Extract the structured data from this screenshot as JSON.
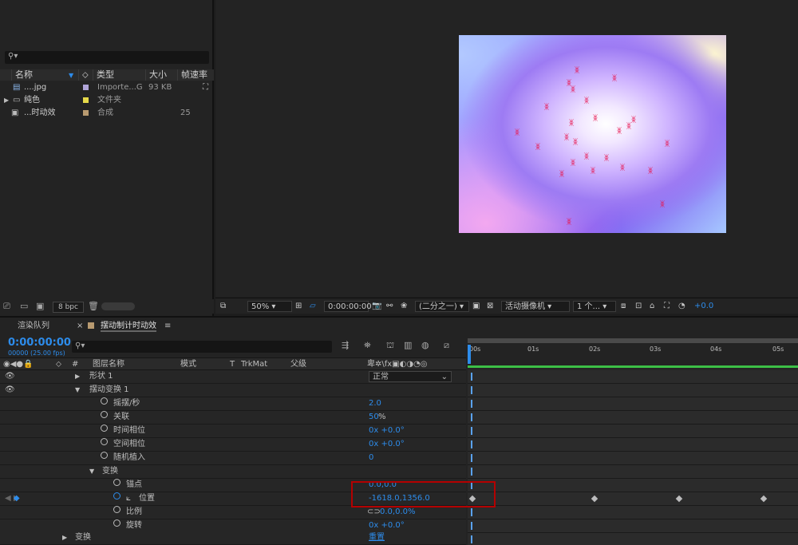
{
  "project": {
    "search_placeholder": "",
    "headers": {
      "name": "名称",
      "type": "类型",
      "size": "大小",
      "fps": "帧速率"
    },
    "items": [
      {
        "name": "....jpg",
        "type": "Importe...G",
        "size": "93 KB",
        "fps": "",
        "color": "#b0a4d8"
      },
      {
        "name": "纯色",
        "type": "文件夹",
        "size": "",
        "fps": "",
        "color": "#e6d94a"
      },
      {
        "name": "...时动效",
        "type": "合成",
        "size": "",
        "fps": "25",
        "color": "#b89a70"
      }
    ],
    "bpc": "8 bpc"
  },
  "viewer": {
    "zoom": "50%",
    "timecode": "0:00:00:00",
    "resolution": "(二分之一)",
    "camera": "活动摄像机",
    "views": "1 个...",
    "exposure": "+0.0"
  },
  "timeline": {
    "tab_render": "渲染队列",
    "tab_comp": "摆动制计时动效",
    "time": "0:00:00:00",
    "fps_info": "00000 (25.00 fps)",
    "columns": {
      "num": "#",
      "layer_name": "图层名称",
      "mode": "模式",
      "t": "T",
      "trkmat": "TrkMat",
      "parent": "父级"
    },
    "ruler_ticks": [
      "00s",
      "01s",
      "02s",
      "03s",
      "04s",
      "05s"
    ],
    "rows": [
      {
        "label": "形状 1",
        "value": "正常"
      },
      {
        "label": "摆动变换 1",
        "value": ""
      },
      {
        "label": "摇摆/秒",
        "value": "2.0"
      },
      {
        "label": "关联",
        "value": "50",
        "unit": "%"
      },
      {
        "label": "时间相位",
        "value": "0x +0.0°"
      },
      {
        "label": "空间相位",
        "value": "0x +0.0°"
      },
      {
        "label": "随机植入",
        "value": "0"
      },
      {
        "label": "变换",
        "value": ""
      },
      {
        "label": "锚点",
        "value": "0.0,0.0"
      },
      {
        "label": "位置",
        "value": "-1618.0,1356.0"
      },
      {
        "label": "比例",
        "value": "0.0,0.0%"
      },
      {
        "label": "旋转",
        "value": "0x +0.0°"
      },
      {
        "label": "变换",
        "value": "重置"
      }
    ]
  }
}
